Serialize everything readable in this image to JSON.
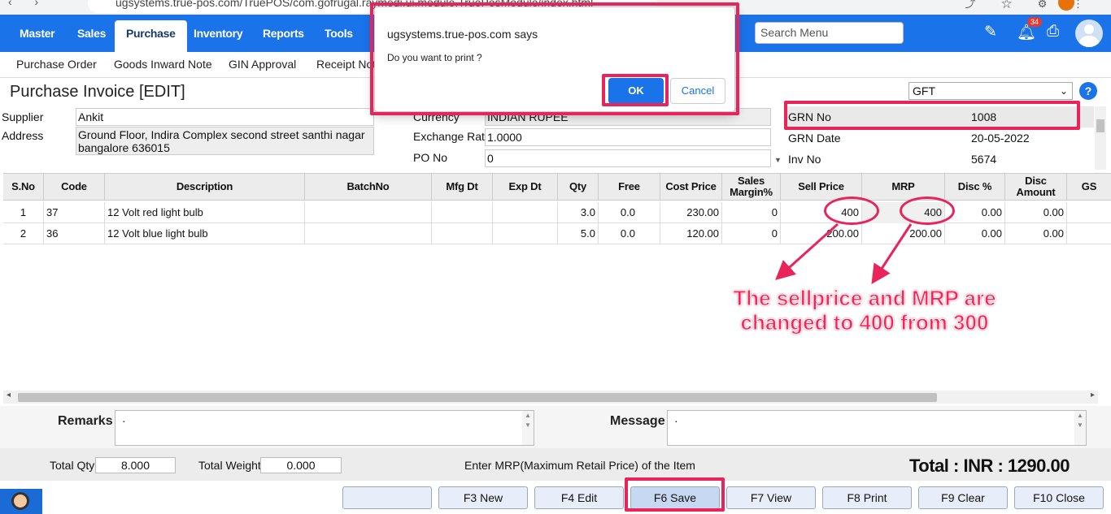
{
  "browser": {
    "url": "ugsystems.true-pos.com/TruePOS/com.gofrugal.raymedi.ui.module.TruePosModule/index.html"
  },
  "nav": {
    "items": [
      "Master",
      "Sales",
      "Purchase",
      "Inventory",
      "Reports",
      "Tools"
    ],
    "active": "Purchase",
    "search_placeholder": "Search Menu",
    "notification_count": "34"
  },
  "subnav": {
    "items": [
      "Purchase Order",
      "Goods Inward Note",
      "GIN Approval",
      "Receipt Note"
    ]
  },
  "form": {
    "title": "Purchase Invoice [EDIT]",
    "gft_value": "GFT",
    "supplier_label": "Supplier",
    "supplier": "Ankit",
    "address_label": "Address",
    "address": "Ground Floor, Indira Complex second street santhi nagar bangalore 636015",
    "currency_label": "Currency",
    "currency": "INDIAN RUPEE",
    "exchange_rate_label": "Exchange Rate",
    "exchange_rate": "1.0000",
    "po_no_label": "PO No",
    "po_no": "0",
    "grn_no_label": "GRN No",
    "grn_no": "1008",
    "grn_date_label": "GRN Date",
    "grn_date": "20-05-2022",
    "inv_no_label": "Inv No",
    "inv_no": "5674"
  },
  "grid": {
    "columns": [
      "S.No",
      "Code",
      "Description",
      "BatchNo",
      "Mfg Dt",
      "Exp Dt",
      "Qty",
      "Free",
      "Cost Price",
      "Sales Margin%",
      "Sell Price",
      "MRP",
      "Disc %",
      "Disc Amount",
      "GS"
    ],
    "rows": [
      [
        "1",
        "37",
        "12 Volt red light bulb",
        "",
        "",
        "",
        "3.0",
        "0.0",
        "230.00",
        "0",
        "400",
        "400",
        "0.00",
        "0.00",
        ""
      ],
      [
        "2",
        "36",
        "12 Volt blue light bulb",
        "",
        "",
        "",
        "5.0",
        "0.0",
        "120.00",
        "0",
        "200.00",
        "200.00",
        "0.00",
        "0.00",
        ""
      ]
    ]
  },
  "annotation": {
    "line1": "The sellprice and MRP are",
    "line2": "changed to 400 from 300"
  },
  "remarks": {
    "label": "Remarks",
    "value": "·"
  },
  "message": {
    "label": "Message",
    "value": "·"
  },
  "totals": {
    "qty_label": "Total Qty",
    "qty": "8.000",
    "weight_label": "Total Weight",
    "weight": "0.000",
    "status": "Enter MRP(Maximum Retail Price) of the Item",
    "total": "Total : INR : 1290.00"
  },
  "buttons": [
    "",
    "F3 New",
    "F4 Edit",
    "F6 Save",
    "F7 View",
    "F8 Print",
    "F9 Clear",
    "F10 Close"
  ],
  "dialog": {
    "title": "ugsystems.true-pos.com says",
    "message": "Do you want to print ?",
    "ok": "OK",
    "cancel": "Cancel"
  },
  "colors": {
    "nav": "#1a73e8",
    "annotation": "#e8245a"
  }
}
